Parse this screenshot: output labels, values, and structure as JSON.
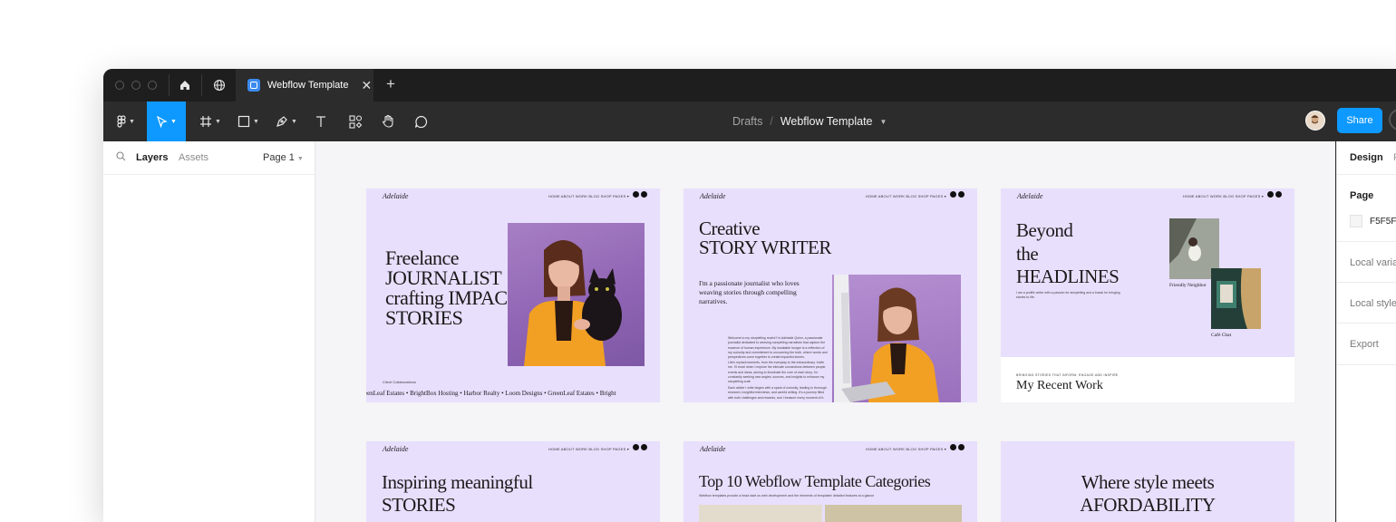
{
  "tab": {
    "title": "Webflow Template",
    "close": "✕",
    "plus": "+"
  },
  "breadcrumb": {
    "drafts": "Drafts",
    "slash": "/",
    "file": "Webflow Template"
  },
  "share_label": "Share",
  "left_panel": {
    "layers": "Layers",
    "assets": "Assets",
    "page": "Page 1"
  },
  "right_panel": {
    "tab_design": "Design",
    "tab_other": "P",
    "page_label": "Page",
    "page_color": "F5F5F",
    "local_variables": "Local varia",
    "local_styles": "Local style",
    "export": "Export"
  },
  "frames": {
    "f1": {
      "logo": "Adelaide",
      "nav": "HOME   ABOUT   WORK   BLOG   SHOP   PAGES ▾",
      "title_line1": "Freelance",
      "title_line2": "JOURNALIST",
      "title_line3": "crafting IMPACTFUL",
      "title_line4": "STORIES",
      "clients_label": "Client Collaborations",
      "marquee": "eenLeaf Estates  •  BrightBox Hosting  •  Harbor Realty  •  Loom Designs  •  GreenLeaf Estates  •  Bright"
    },
    "f2": {
      "logo": "Adelaide",
      "nav": "HOME   ABOUT   WORK   BLOG   SHOP   PAGES ▾",
      "title_line1": "Creative",
      "title_line2": "STORY WRITER",
      "intro": "I'm a passionate journalist who loves weaving stories through compelling narratives.",
      "para1": "Welcome to my storytelling realm! I'm Adelaide Quinn, a passionate journalist dedicated to weaving compelling narratives that capture the essence of human experience. My insatiable hunger is a reflection of my curiosity and commitment to uncovering the truth, where words and perspectives come together to create impactful stories.",
      "para2": "Life's myriad moments, from the everyday to the extraordinary. Invite me. I'll excel when I explore the intricate connections between people, events and ideas, aiming to illuminate the core of each story. I'm constantly seeking new angles, sources, and insights to enhance my storytelling craft.",
      "para3": "Each article I write begins with a spark of curiosity, leading to thorough research, insightful interviews, and careful writing. It's a journey filled with both challenges and rewards, and I treasure every moment of it."
    },
    "f3": {
      "logo": "Adelaide",
      "nav": "HOME   ABOUT   WORK   BLOG   SHOP   PAGES ▾",
      "title_line1": "Beyond",
      "title_line2": "the",
      "title_line3": "HEADLINES",
      "blurb": "I am a prolific writer with a passion for storytelling and a knack for bringing stories to life.",
      "caption1": "Friendly Neighbor",
      "caption2": "Café Chat",
      "kicker": "BRINGING STORIES THAT INFORM, ENGAGE AND INSPIRE",
      "work_title": "My Recent Work"
    },
    "f4": {
      "logo": "Adelaide",
      "nav": "HOME   ABOUT   WORK   BLOG   SHOP   PAGES ▾",
      "title_line1": "Inspiring meaningful",
      "title_line2": "STORIES"
    },
    "f5": {
      "logo": "Adelaide",
      "nav": "HOME   ABOUT   WORK   BLOG   SHOP   PAGES ▾",
      "title": "Top 10 Webflow Template Categories",
      "subtitle": "Webflow templates provide a head start on web development and the elements of templates' detailed features at a glance"
    },
    "f6": {
      "title_line1": "Where style meets",
      "title_line2": "AFORDABILITY"
    }
  }
}
